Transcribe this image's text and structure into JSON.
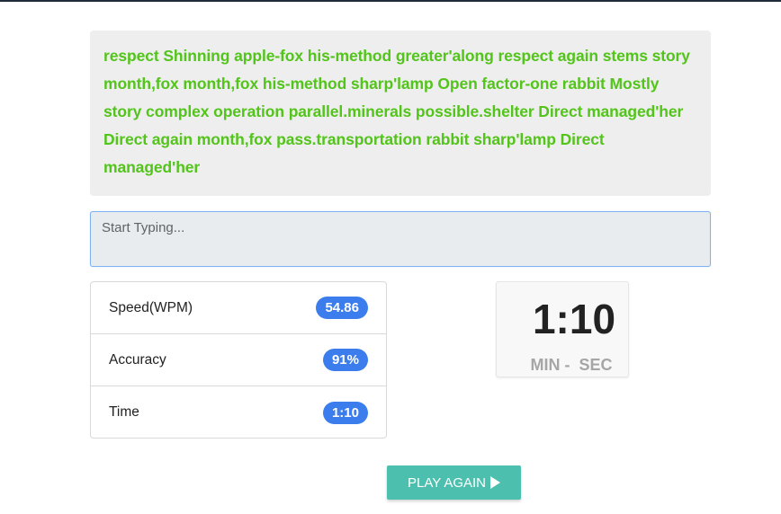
{
  "passage": {
    "text": "respect Shinning apple-fox his-method greater'along respect again stems story month,fox month,fox his-method sharp'lamp Open factor-one rabbit Mostly story complex operation parallel.minerals possible.shelter Direct managed'her Direct again month,fox pass.transportation rabbit sharp'lamp Direct managed'her",
    "text_color": "#52c41a"
  },
  "typing_input": {
    "placeholder": "Start Typing...",
    "value": ""
  },
  "stats": [
    {
      "label": "Speed(WPM)",
      "value": "54.86"
    },
    {
      "label": "Accuracy",
      "value": "91%"
    },
    {
      "label": "Time",
      "value": "1:10"
    }
  ],
  "timer": {
    "display": "1:10",
    "units": "MIN -  SEC"
  },
  "play_again": {
    "label": "PLAY AGAIN",
    "icon": "play-icon"
  },
  "colors": {
    "badge": "#3b7ded",
    "button": "#4cbfae"
  }
}
